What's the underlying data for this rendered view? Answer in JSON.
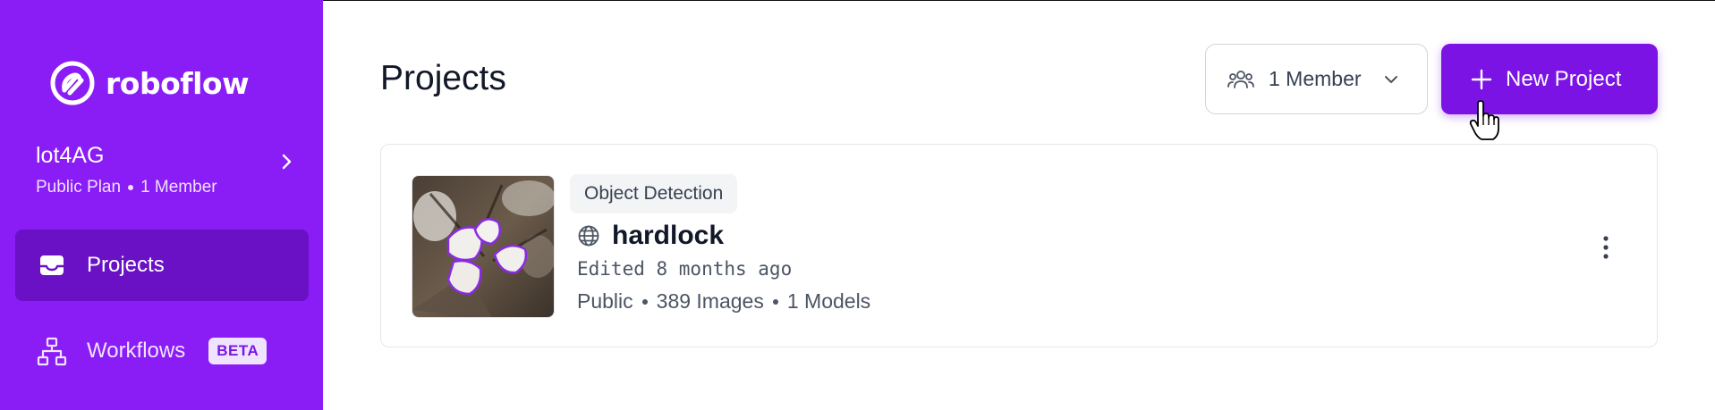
{
  "brand": {
    "name": "roboflow",
    "color": "#8a1cf5"
  },
  "workspace": {
    "name": "lot4AG",
    "plan": "Public Plan",
    "members": "1 Member"
  },
  "nav": {
    "projects": {
      "label": "Projects",
      "icon": "inbox-tray-icon"
    },
    "workflows": {
      "label": "Workflows",
      "badge": "BETA",
      "icon": "workflow-tree-icon"
    }
  },
  "header": {
    "title": "Projects",
    "member_filter": "1 Member",
    "new_project": "New Project"
  },
  "project": {
    "type": "Object Detection",
    "name": "hardlock",
    "edited": "Edited 8 months ago",
    "visibility": "Public",
    "images": "389 Images",
    "models": "1 Models"
  }
}
